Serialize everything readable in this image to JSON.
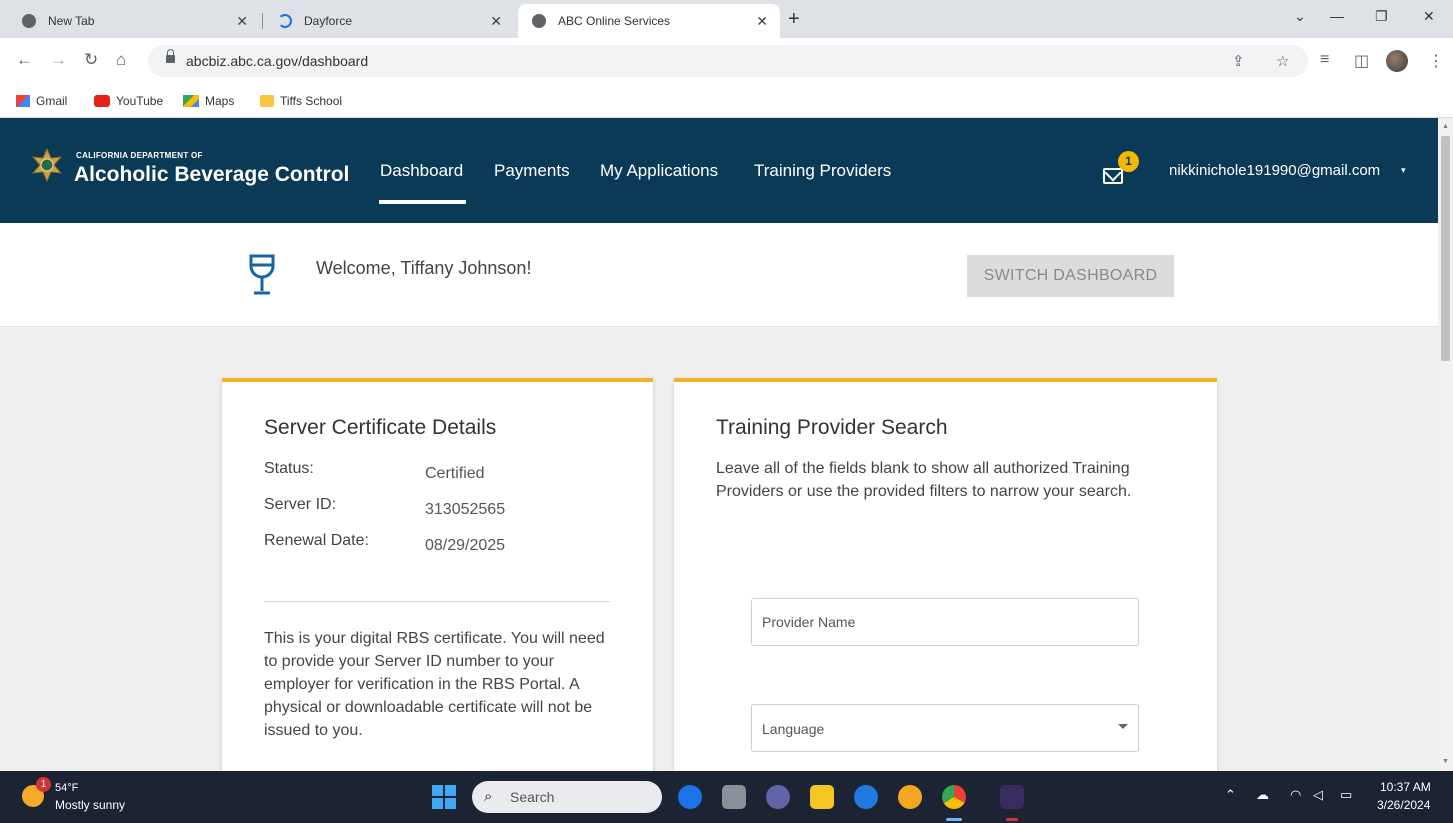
{
  "browser": {
    "tabs": [
      {
        "title": "New Tab",
        "active": false
      },
      {
        "title": "Dayforce",
        "active": false
      },
      {
        "title": "ABC Online Services",
        "active": true
      }
    ],
    "new_tab": "+",
    "url": "abcbiz.abc.ca.gov/dashboard",
    "bookmarks": [
      "Gmail",
      "YouTube",
      "Maps",
      "Tiffs School"
    ]
  },
  "header": {
    "dept_line": "CALIFORNIA DEPARTMENT OF",
    "agency": "Alcoholic Beverage Control",
    "nav": [
      "Dashboard",
      "Payments",
      "My Applications",
      "Training Providers"
    ],
    "active_nav": "Dashboard",
    "notification_count": "1",
    "user_email": "nikkinichole191990@gmail.com",
    "user_caret": "▾"
  },
  "welcome": {
    "message": "Welcome, Tiffany Johnson!",
    "switch_button": "SWITCH DASHBOARD"
  },
  "certificate": {
    "title": "Server Certificate Details",
    "rows": [
      {
        "label": "Status:",
        "value": "Certified"
      },
      {
        "label": "Server ID:",
        "value": "313052565"
      },
      {
        "label": "Renewal Date:",
        "value": "08/29/2025"
      }
    ],
    "note": "This is your digital RBS certificate. You will need to provide your Server ID number to your employer for verification in the RBS Portal. A physical or downloadable certificate will not be issued to you."
  },
  "provider_search": {
    "title": "Training Provider Search",
    "description": "Leave all of the fields blank to show all authorized Training Providers or use the provided filters to narrow your search.",
    "provider_name_placeholder": "Provider Name",
    "language_placeholder": "Language"
  },
  "taskbar": {
    "weather_badge": "1",
    "temperature": "54°F",
    "condition": "Mostly sunny",
    "search_label": "Search",
    "time": "10:37 AM",
    "date": "3/26/2024"
  },
  "colors": {
    "header_bg": "#0b3a56",
    "card_accent": "#f0b323",
    "badge": "#f5b800"
  }
}
